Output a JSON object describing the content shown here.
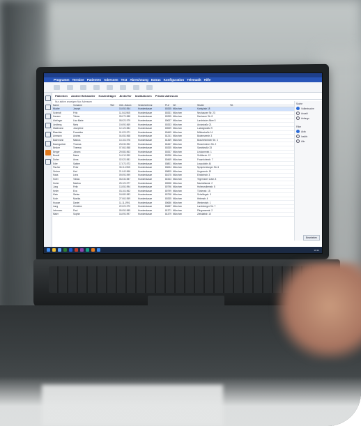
{
  "screen_app": {
    "menu": [
      "Programm",
      "Termine",
      "Patienten",
      "Adressen",
      "Text",
      "Abrechnung",
      "Extras",
      "Konfiguration",
      "Telematik",
      "Hilfe"
    ],
    "tabs": [
      "Patienten",
      "Andere Behandler",
      "Kostenträger",
      "Ärzte/Ver",
      "Institutionen",
      "Private Adressen"
    ],
    "filter": "Nur aktive anzeigen  Nur Adressen",
    "columns": [
      "Name",
      "Vorname",
      "Titel",
      "Geb.-Datum",
      "Versichertennr.",
      "PLZ",
      "Ort",
      "Straße",
      "Tel."
    ],
    "rows": [
      [
        "Muster",
        "Joseph",
        "",
        "15.05.1954",
        "Krankenkasse",
        "80335",
        "München",
        "Karlsplatz 18",
        ""
      ],
      [
        "Schmidt",
        "Fritz",
        "",
        "11.04.1965",
        "Krankenkasse",
        "80331",
        "München",
        "Neuhauser Str. 23",
        ""
      ],
      [
        "Hansen",
        "Tobias",
        "",
        "05.07.1988",
        "Krankenkasse",
        "80335",
        "München",
        "Dachauer Str. 8",
        ""
      ],
      [
        "Aichinger",
        "Lisa Marie",
        "",
        "08.02.1979",
        "Krankenkasse",
        "80637",
        "München",
        "Landshuter Allee 5",
        ""
      ],
      [
        "Lindberg",
        "Niels",
        "",
        "19.09.1969",
        "Krankenkasse",
        "80333",
        "München",
        "Arcisstraße 21",
        ""
      ],
      [
        "Waldmann",
        "Josephine",
        "",
        "12.12.1984",
        "Krankenkasse",
        "80539",
        "München",
        "Ludwigstraße 9",
        ""
      ],
      [
        "Blaschke",
        "Franziska",
        "",
        "01.02.1971",
        "Krankenkasse",
        "80469",
        "München",
        "Müllerstraße 14",
        ""
      ],
      [
        "Ammann",
        "Andrea",
        "",
        "04.05.1968",
        "Krankenkasse",
        "81241",
        "München",
        "Bodenseestr. 3",
        ""
      ],
      [
        "Bachmann",
        "Markus",
        "",
        "10.10.1976",
        "Krankenkasse",
        "81369",
        "München",
        "Boschetsrieder Str. 4",
        ""
      ],
      [
        "Baumgartner",
        "Thomas",
        "",
        "23.03.1992",
        "Krankenkasse",
        "81667",
        "München",
        "Rosenheimer Str. 2",
        ""
      ],
      [
        "Becker",
        "Theresa",
        "",
        "07.06.1958",
        "Krankenkasse",
        "80335",
        "München",
        "Sandstraße 33",
        ""
      ],
      [
        "Berger",
        "Johann",
        "",
        "29.08.1963",
        "Krankenkasse",
        "80337",
        "München",
        "Lindwurmstr. 1",
        ""
      ],
      [
        "Brandl",
        "Maria",
        "",
        "14.01.1990",
        "Krankenkasse",
        "80336",
        "München",
        "Schillerstr. 12",
        ""
      ],
      [
        "Dorfer",
        "Anna",
        "",
        "02.02.1981",
        "Krankenkasse",
        "80469",
        "München",
        "Fraunhoferstr. 7",
        ""
      ],
      [
        "Eder",
        "Sabine",
        "",
        "17.07.1973",
        "Krankenkasse",
        "80801",
        "München",
        "Leopoldstr. 44",
        ""
      ],
      [
        "Fischer",
        "Peter",
        "",
        "30.11.1955",
        "Krankenkasse",
        "80634",
        "München",
        "Nymphenburger Str. 6",
        ""
      ],
      [
        "Gruber",
        "Karl",
        "",
        "21.04.1966",
        "Krankenkasse",
        "80809",
        "München",
        "Ungererstr. 19",
        ""
      ],
      [
        "Haas",
        "Lena",
        "",
        "09.09.1999",
        "Krankenkasse",
        "81675",
        "München",
        "Einsteinstr. 3",
        ""
      ],
      [
        "Hofer",
        "Tobias",
        "",
        "06.03.1987",
        "Krankenkasse",
        "81543",
        "München",
        "Tegernseer Ldstr. 8",
        ""
      ],
      [
        "Huber",
        "Martina",
        "",
        "25.12.1977",
        "Krankenkasse",
        "80538",
        "München",
        "Maximilianstr. 2",
        ""
      ],
      [
        "Jung",
        "Felix",
        "",
        "13.05.1994",
        "Krankenkasse",
        "80796",
        "München",
        "Hohenzollernstr. 5",
        ""
      ],
      [
        "Keller",
        "Eva",
        "",
        "03.10.1962",
        "Krankenkasse",
        "80799",
        "München",
        "Türkenstr. 15",
        ""
      ],
      [
        "Klein",
        "Stefan",
        "",
        "18.08.1983",
        "Krankenkasse",
        "80798",
        "München",
        "Schellingstr. 9",
        ""
      ],
      [
        "Koch",
        "Monika",
        "",
        "27.06.1959",
        "Krankenkasse",
        "80335",
        "München",
        "Hirtenstr. 4",
        ""
      ],
      [
        "Krause",
        "Daniel",
        "",
        "11.11.1991",
        "Krankenkasse",
        "80686",
        "München",
        "Westendstr. 1",
        ""
      ],
      [
        "Lang",
        "Christine",
        "",
        "22.02.1970",
        "Krankenkasse",
        "80687",
        "München",
        "Landsberger Str. 7",
        ""
      ],
      [
        "Lehmann",
        "Paul",
        "",
        "05.05.1985",
        "Krankenkasse",
        "81371",
        "München",
        "Plinganserstr. 2",
        ""
      ],
      [
        "Maier",
        "Sophie",
        "",
        "16.09.1997",
        "Krankenkasse",
        "81379",
        "München",
        "Zielstattstr. 10",
        ""
      ]
    ],
    "right_panel": {
      "title": "Suche",
      "options": [
        "Volltextsuche",
        "Anzahl",
        "Anfangs"
      ],
      "title2": "Filter",
      "options2": [
        "Aktiv",
        "Inaktiv",
        "Alle"
      ]
    },
    "footer_button": "Bearbeiten",
    "clock": "10:12"
  }
}
